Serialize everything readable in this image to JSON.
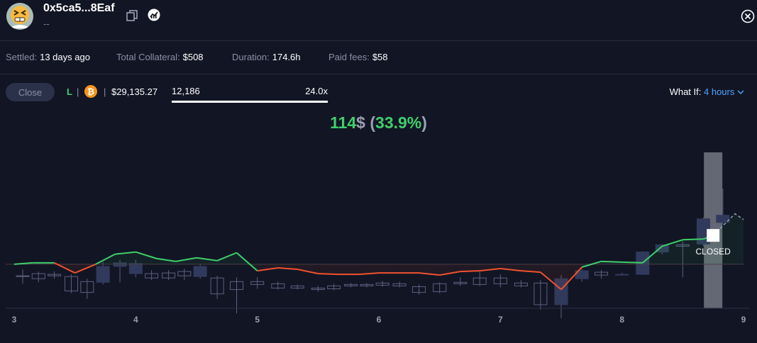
{
  "header": {
    "address": "0x5ca5...8Eaf",
    "subtitle": "--",
    "avatar_icon": "grimace-emoji-avatar",
    "copy_icon": "copy-icon",
    "chart_icon": "chart-link-icon",
    "close_icon": "close-circle-icon"
  },
  "stats": [
    {
      "label": "Settled:",
      "value": "13 days ago"
    },
    {
      "label": "Total Collateral:",
      "value": "$508"
    },
    {
      "label": "Duration:",
      "value": "174.6h"
    },
    {
      "label": "Paid fees:",
      "value": "$58"
    }
  ],
  "controls": {
    "close_label": "Close",
    "side": "L",
    "separator": "|",
    "asset_icon": "bitcoin-icon",
    "price": "$29,135.27",
    "size": "12,186",
    "leverage": "24.0x",
    "whatif_label": "What If:",
    "whatif_value": "4 hours",
    "whatif_chevron": "chevron-down-icon"
  },
  "pnl": {
    "amount": "114",
    "currency": "$",
    "percent_open": " (",
    "percent": "33.9%",
    "percent_close": ")"
  },
  "colors": {
    "background": "#121524",
    "profit": "#3fcf6a",
    "loss": "#f0522f",
    "accent": "#4aa3ff",
    "candle": "#313a5c"
  },
  "chart_data": {
    "type": "line",
    "x_ticks": [
      "3",
      "4",
      "5",
      "6",
      "7",
      "8",
      "9"
    ],
    "x_range": [
      3,
      9
    ],
    "y_range": [
      -60,
      160
    ],
    "baseline": 0,
    "closed_label": "CLOSED",
    "closed_at_x": 8.75,
    "pnl_series": {
      "x": [
        3.0,
        3.15,
        3.33,
        3.5,
        3.67,
        3.83,
        4.0,
        4.17,
        4.33,
        4.5,
        4.67,
        4.83,
        5.0,
        5.17,
        5.33,
        5.5,
        5.67,
        5.83,
        6.0,
        6.17,
        6.33,
        6.5,
        6.67,
        6.83,
        7.0,
        7.17,
        7.33,
        7.5,
        7.67,
        7.83,
        8.0,
        8.17,
        8.33,
        8.5,
        8.67,
        8.75
      ],
      "y": [
        0,
        2,
        2,
        -12,
        0,
        14,
        17,
        8,
        4,
        9,
        5,
        16,
        -9,
        -5,
        -7,
        -13,
        -14,
        -14,
        -12,
        -12,
        -12,
        -15,
        -10,
        -9,
        -6,
        -9,
        -11,
        -35,
        -4,
        4,
        3,
        2,
        25,
        34,
        35,
        40
      ]
    },
    "projection_series": {
      "x": [
        8.75,
        8.93,
        9.0
      ],
      "y": [
        40,
        70,
        62
      ]
    },
    "candles": [
      {
        "x": 3.07,
        "o": -16,
        "c": -17,
        "h": -7,
        "l": -27
      },
      {
        "x": 3.2,
        "o": -13,
        "c": -20,
        "h": -10,
        "l": -25
      },
      {
        "x": 3.33,
        "o": -14,
        "c": -16,
        "h": -10,
        "l": -20
      },
      {
        "x": 3.47,
        "o": -17,
        "c": -37,
        "h": -14,
        "l": -40
      },
      {
        "x": 3.6,
        "o": -24,
        "c": -39,
        "h": -20,
        "l": -48
      },
      {
        "x": 3.73,
        "o": -25,
        "c": -3,
        "h": 3,
        "l": -28
      },
      {
        "x": 3.87,
        "o": -3,
        "c": 2,
        "h": 6,
        "l": -25
      },
      {
        "x": 4.0,
        "o": -13,
        "c": 1,
        "h": 6,
        "l": -18
      },
      {
        "x": 4.13,
        "o": -13,
        "c": -19,
        "h": -8,
        "l": -22
      },
      {
        "x": 4.27,
        "o": -12,
        "c": -19,
        "h": -8,
        "l": -22
      },
      {
        "x": 4.4,
        "o": -10,
        "c": -16,
        "h": -6,
        "l": -22
      },
      {
        "x": 4.53,
        "o": -17,
        "c": -3,
        "h": 0,
        "l": -20
      },
      {
        "x": 4.67,
        "o": -19,
        "c": -41,
        "h": -16,
        "l": -48
      },
      {
        "x": 4.83,
        "o": -24,
        "c": -35,
        "h": -18,
        "l": -68
      },
      {
        "x": 5.0,
        "o": -24,
        "c": -28,
        "h": -18,
        "l": -34
      },
      {
        "x": 5.17,
        "o": -27,
        "c": -33,
        "h": -24,
        "l": -35
      },
      {
        "x": 5.33,
        "o": -30,
        "c": -33,
        "h": -28,
        "l": -35
      },
      {
        "x": 5.5,
        "o": -33,
        "c": -35,
        "h": -30,
        "l": -38
      },
      {
        "x": 5.63,
        "o": -30,
        "c": -34,
        "h": -27,
        "l": -36
      },
      {
        "x": 5.77,
        "o": -28,
        "c": -30,
        "h": -26,
        "l": -32
      },
      {
        "x": 5.9,
        "o": -28,
        "c": -30,
        "h": -26,
        "l": -32
      },
      {
        "x": 6.03,
        "o": -26,
        "c": -29,
        "h": -23,
        "l": -31
      },
      {
        "x": 6.17,
        "o": -27,
        "c": -30,
        "h": -24,
        "l": -32
      },
      {
        "x": 6.33,
        "o": -31,
        "c": -39,
        "h": -28,
        "l": -42
      },
      {
        "x": 6.5,
        "o": -27,
        "c": -38,
        "h": -25,
        "l": -40
      },
      {
        "x": 6.67,
        "o": -25,
        "c": -27,
        "h": -18,
        "l": -30
      },
      {
        "x": 6.83,
        "o": -19,
        "c": -28,
        "h": -10,
        "l": -30
      },
      {
        "x": 7.0,
        "o": -19,
        "c": -27,
        "h": -14,
        "l": -32
      },
      {
        "x": 7.17,
        "o": -26,
        "c": -30,
        "h": -22,
        "l": -32
      },
      {
        "x": 7.33,
        "o": -26,
        "c": -56,
        "h": -22,
        "l": -63
      },
      {
        "x": 7.5,
        "o": -56,
        "c": -20,
        "h": -15,
        "l": -75
      },
      {
        "x": 7.67,
        "o": -20,
        "c": -9,
        "h": -6,
        "l": -24
      },
      {
        "x": 7.83,
        "o": -11,
        "c": -15,
        "h": -8,
        "l": -20
      },
      {
        "x": 8.0,
        "o": -14,
        "c": -14,
        "h": -12,
        "l": -15
      },
      {
        "x": 8.17,
        "o": -14,
        "c": 17,
        "h": 18,
        "l": -14
      },
      {
        "x": 8.33,
        "o": 17,
        "c": 27,
        "h": 28,
        "l": 14
      },
      {
        "x": 8.5,
        "o": 27,
        "c": 25,
        "h": 32,
        "l": -18
      },
      {
        "x": 8.67,
        "o": 28,
        "c": 63,
        "h": 65,
        "l": 25
      },
      {
        "x": 8.83,
        "o": 58,
        "c": 68,
        "h": 105,
        "l": 55
      }
    ]
  }
}
